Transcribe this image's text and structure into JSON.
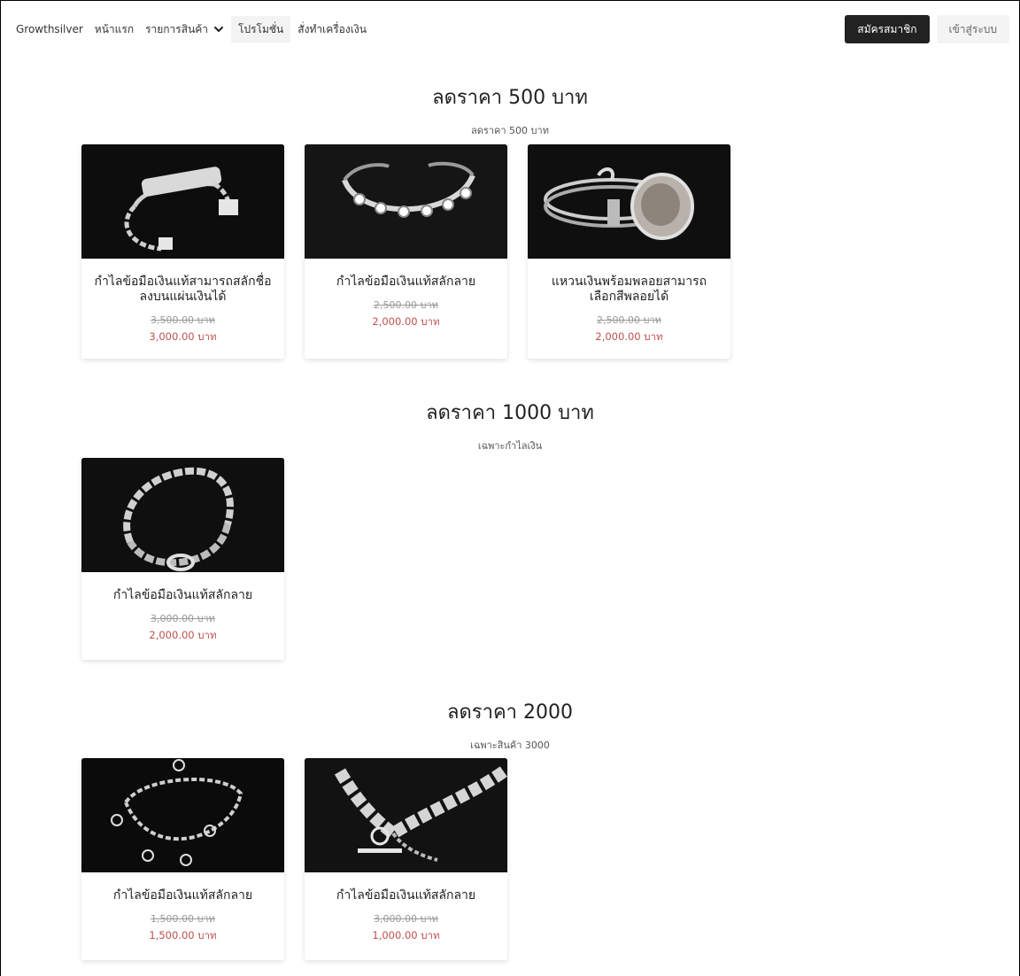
{
  "nav": {
    "brand": "Growthsilver",
    "home": "หน้าแรก",
    "products": "รายการสินค้า",
    "promotion": "โปรโมชั่น",
    "order": "สั่งทำเครื่องเงิน",
    "signup": "สมัครสมาชิก",
    "login": "เข้าสู่ระบบ"
  },
  "sections": [
    {
      "title": "ลดราคา 500 บาท",
      "subtitle": "ลดราคา 500 บาท",
      "products": [
        {
          "name": "กำไลข้อมือเงินแท้สามารถสลักชื่อลงบนแผ่นเงินได้",
          "old_price": "3,500.00 บาท",
          "price": "3,000.00 บาท"
        },
        {
          "name": "กำไลข้อมือเงินแท้สลักลาย",
          "old_price": "2,500.00 บาท",
          "price": "2,000.00 บาท"
        },
        {
          "name": "แหวนเงินพร้อมพลอยสามารถเลือกสีพลอยได้",
          "old_price": "2,500.00 บาท",
          "price": "2,000.00 บาท"
        }
      ]
    },
    {
      "title": "ลดราคา 1000 บาท",
      "subtitle": "เฉพาะกำไลเงิน",
      "products": [
        {
          "name": "กำไลข้อมือเงินแท้สลักลาย",
          "old_price": "3,000.00 บาท",
          "price": "2,000.00 บาท"
        }
      ]
    },
    {
      "title": "ลดราคา 2000",
      "subtitle": "เฉพาะสินค้า 3000",
      "products": [
        {
          "name": "กำไลข้อมือเงินแท้สลักลาย",
          "old_price": "1,500.00 บาท",
          "price": "1,500.00 บาท"
        },
        {
          "name": "กำไลข้อมือเงินแท้สลักลาย",
          "old_price": "3,000.00 บาท",
          "price": "1,000.00 บาท"
        }
      ]
    }
  ],
  "colors": {
    "sale_price": "#c0504d",
    "signup_bg": "#222222",
    "image_bg": "#0d0d0d"
  },
  "icons": {
    "products_dropdown": "chevron-down-icon"
  }
}
